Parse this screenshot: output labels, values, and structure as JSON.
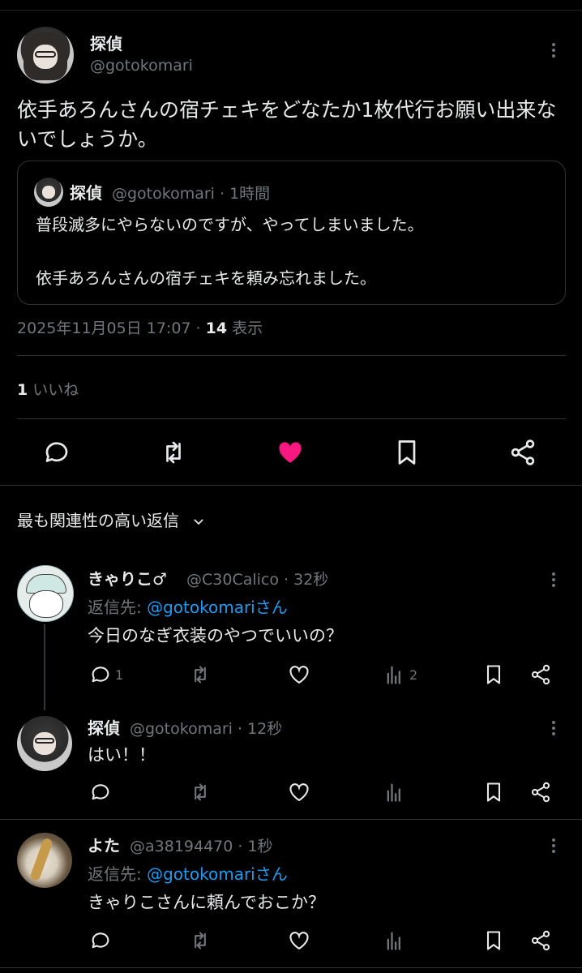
{
  "main_tweet": {
    "author_name": "探偵",
    "author_handle": "@gotokomari",
    "text": "依手あろんさんの宿チェキをどなたか1枚代行お願い出来ないでしょうか。",
    "quote": {
      "author_name": "探偵",
      "author_handle": "@gotokomari · 1時間",
      "text": "普段滅多にやらないのですが、やってしまいました。\n\n依手あろんさんの宿チェキを頼み忘れました。"
    },
    "timestamp": "2025年11月05日 17:07 · ",
    "views_count": "14",
    "views_label": " 表示",
    "likes_count": "1",
    "likes_label": " いいね",
    "liked": true
  },
  "colors": {
    "background": "#000000",
    "text": "#e7e9ea",
    "secondary": "#71767b",
    "like_active": "#f91880",
    "mention": "#1d9bf0",
    "divider": "#2f3336"
  },
  "replies_section": {
    "title": "最も関連性の高い返信"
  },
  "replies": [
    {
      "author_name": "きゃりこ♂",
      "author_handle": "@C30Calico · 32秒",
      "reply_to_prefix": "返信先: ",
      "reply_to_mention": "@gotokomari",
      "reply_to_suffix": "さん",
      "text": "今日のなぎ衣装のやつでいいの？",
      "reply_count": "1",
      "views_count": "2"
    },
    {
      "author_name": "探偵",
      "author_handle": "@gotokomari · 12秒",
      "text": "はい！！",
      "reply_count": "",
      "views_count": ""
    },
    {
      "author_name": "よた",
      "author_handle": "@a38194470 · 1秒",
      "reply_to_prefix": "返信先: ",
      "reply_to_mention": "@gotokomari",
      "reply_to_suffix": "さん",
      "text": "きゃりこさんに頼んでおこか？",
      "reply_count": "",
      "views_count": ""
    }
  ]
}
